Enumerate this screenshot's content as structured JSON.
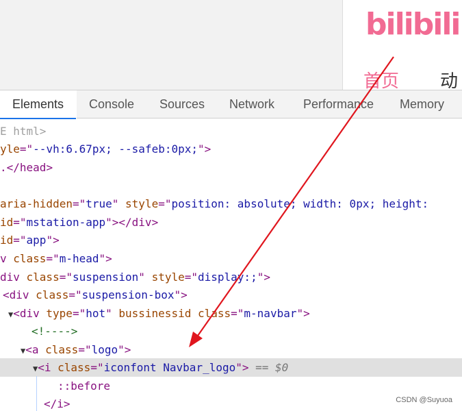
{
  "preview": {
    "logo_text": "bilibili",
    "nav_home": "首页",
    "nav_anim": "动画"
  },
  "tabs": [
    {
      "label": "Elements",
      "active": true
    },
    {
      "label": "Console",
      "active": false
    },
    {
      "label": "Sources",
      "active": false
    },
    {
      "label": "Network",
      "active": false
    },
    {
      "label": "Performance",
      "active": false
    },
    {
      "label": "Memory",
      "active": false
    }
  ],
  "code": {
    "l1": "E html>",
    "l2_a": "yle",
    "l2_b": "=\"",
    "l2_c": "--vh:6.67px; --safeb:0px;",
    "l2_d": "\">",
    "l3_a": ".</",
    "l3_b": "head",
    "l3_c": ">",
    "l4_a": "aria-hidden",
    "l4_b": "=\"",
    "l4_c": "true",
    "l4_d": "\" ",
    "l4_e": "style",
    "l4_f": "=\"",
    "l4_g": "position: absolute; width: 0px; height:",
    "l5_a": "id",
    "l5_b": "=\"",
    "l5_c": "mstation-app",
    "l5_d": "\"></",
    "l5_e": "div",
    "l5_f": ">",
    "l6_a": "id",
    "l6_b": "=\"",
    "l6_c": "app",
    "l6_d": "\">",
    "l7_a": "v ",
    "l7_b": "class",
    "l7_c": "=\"",
    "l7_d": "m-head",
    "l7_e": "\">",
    "l8_a": "div ",
    "l8_b": "class",
    "l8_c": "=\"",
    "l8_d": "suspension",
    "l8_e": "\" ",
    "l8_f": "style",
    "l8_g": "=\"",
    "l8_h": "display:;",
    "l8_i": "\">",
    "l9_a": "<div ",
    "l9_b": "class",
    "l9_c": "=\"",
    "l9_d": "suspension-box",
    "l9_e": "\">",
    "l10_a": "<div ",
    "l10_b": "type",
    "l10_c": "=\"",
    "l10_d": "hot",
    "l10_e": "\" ",
    "l10_f": "bussinessid",
    "l10_g": " class",
    "l10_h": "=\"",
    "l10_i": "m-navbar",
    "l10_j": "\">",
    "l11": "<!---->",
    "l12_a": "<a ",
    "l12_b": "class",
    "l12_c": "=\"",
    "l12_d": "logo",
    "l12_e": "\">",
    "l13_a": "<i ",
    "l13_b": "class",
    "l13_c": "=\"",
    "l13_d": "iconfont Navbar_logo",
    "l13_e": "\">",
    "l13_f": " == ",
    "l13_g": "$0",
    "l14": "::before",
    "l15": "</i>"
  },
  "watermark": "CSDN @Suyuoa",
  "colors": {
    "brand_pink": "#f16b93",
    "arrow_red": "#e0161e",
    "tab_underline": "#1a73e8"
  }
}
